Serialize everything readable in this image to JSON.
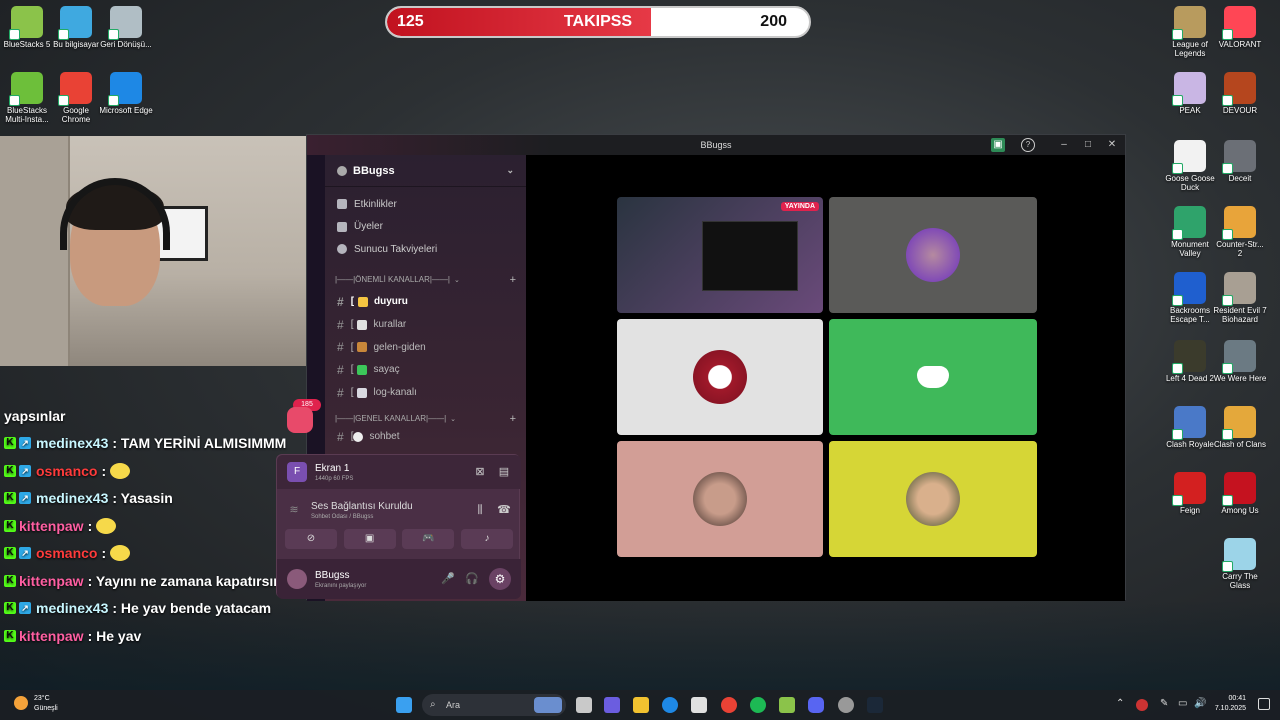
{
  "goal": {
    "label": "TAKIPSS",
    "current": "125",
    "target": "200",
    "progress": 0.625
  },
  "desktop_icons": [
    {
      "label": "BlueStacks 5",
      "color": "#8bc34a"
    },
    {
      "label": "Bu bilgisayar",
      "color": "#3fa9e0"
    },
    {
      "label": "Geri Dönüşü...",
      "color": "#b0bec5"
    },
    {
      "label": "BlueStacks Multi-Insta...",
      "color": "#6dbf3a"
    },
    {
      "label": "Google Chrome",
      "color": "#e94235"
    },
    {
      "label": "Microsoft Edge",
      "color": "#1e88e5"
    },
    {
      "label": "League of Legends",
      "color": "#b89b5e"
    },
    {
      "label": "VALORANT",
      "color": "#ff4655"
    },
    {
      "label": "PEAK",
      "color": "#c9b6e4"
    },
    {
      "label": "DEVOUR",
      "color": "#b5461e"
    },
    {
      "label": "Goose Goose Duck",
      "color": "#f2f2f2"
    },
    {
      "label": "Deceit",
      "color": "#6b6f76"
    },
    {
      "label": "Monument Valley",
      "color": "#2fa36b"
    },
    {
      "label": "Counter-Str... 2",
      "color": "#e8a43a"
    },
    {
      "label": "Backrooms Escape T...",
      "color": "#1f5fcf"
    },
    {
      "label": "Resident Evil 7 Biohazard",
      "color": "#a89f93"
    },
    {
      "label": "Left 4 Dead 2",
      "color": "#3b3b2c"
    },
    {
      "label": "We Were Here",
      "color": "#6b7a83"
    },
    {
      "label": "Clash Royale",
      "color": "#4a79c8"
    },
    {
      "label": "Clash of Clans",
      "color": "#e4a83b"
    },
    {
      "label": "Feign",
      "color": "#d32020"
    },
    {
      "label": "Among Us",
      "color": "#c5121f"
    },
    {
      "label": "Carry The Glass",
      "color": "#9cd4e8"
    }
  ],
  "chat": [
    {
      "user": "",
      "message": "yapsınlar",
      "color": "#ffffff",
      "badges": []
    },
    {
      "user": "medinex43",
      "message": ": TAM YERİNİ ALMISIMMM",
      "color": "#c8f7ff",
      "badges": [
        "k",
        "s"
      ]
    },
    {
      "user": "osmanco",
      "message": ":",
      "color": "#ff3b3b",
      "badges": [
        "k",
        "s"
      ],
      "emote": true
    },
    {
      "user": "medinex43",
      "message": ": Yasasin",
      "color": "#c8f7ff",
      "badges": [
        "k",
        "s"
      ]
    },
    {
      "user": "kittenpaw",
      "message": ":",
      "color": "#ff5fa2",
      "badges": [
        "k"
      ],
      "emote": true
    },
    {
      "user": "osmanco",
      "message": ":",
      "color": "#ff3b3b",
      "badges": [
        "k",
        "s"
      ],
      "emote": true
    },
    {
      "user": "kittenpaw",
      "message": ": Yayını ne zamana kapatırsın",
      "color": "#ff5fa2",
      "badges": [
        "k"
      ]
    },
    {
      "user": "medinex43",
      "message": ": He yav bende yatacam",
      "color": "#c8f7ff",
      "badges": [
        "k",
        "s"
      ]
    },
    {
      "user": "kittenpaw",
      "message": ": He yav",
      "color": "#ff5fa2",
      "badges": [
        "k"
      ]
    }
  ],
  "discord": {
    "window_title": "BBugss",
    "server_name": "BBugss",
    "menu": [
      "Etkinlikler",
      "Üyeler",
      "Sunucu Takviyeleri"
    ],
    "category1": "|——|ÖNEMLİ KANALLAR|——|",
    "channels": [
      {
        "name": "duyuru",
        "bracket": "[",
        "emoji_color": "#f5c542",
        "active": true
      },
      {
        "name": "kurallar",
        "bracket": "[",
        "emoji_color": "#e0e0e0",
        "active": false
      },
      {
        "name": "gelen-giden",
        "bracket": "[",
        "emoji_color": "#c9873a",
        "active": false
      },
      {
        "name": "sayaç",
        "bracket": "[",
        "emoji_color": "#3cc75a",
        "active": false
      },
      {
        "name": "log-kanalı",
        "bracket": "[",
        "emoji_color": "#d8d8e0",
        "active": false
      }
    ],
    "category2": "|——|GENEL KANALLAR|——|",
    "partial_channel": "sohbet",
    "server_badge": "185",
    "panel": {
      "stream_title": "Ekran 1",
      "stream_sub": "1440p 60 FPS",
      "voice_status": "Ses Bağlantısı Kuruldu",
      "voice_channel": "Sohbet Odası / BBugss",
      "user_name": "BBugss",
      "user_status": "Ekranını paylaşıyor"
    },
    "live_badge": "YAYINDA",
    "tile_colors": [
      "#2a3440",
      "#5a5a58",
      "#e2e2e2",
      "#3fb95a",
      "#d29e96",
      "#d6d636"
    ]
  },
  "taskbar": {
    "search_placeholder": "Ara",
    "weather_temp": "23°C",
    "weather_desc": "Güneşli",
    "time": "00:41",
    "date": "7.10.2025"
  }
}
